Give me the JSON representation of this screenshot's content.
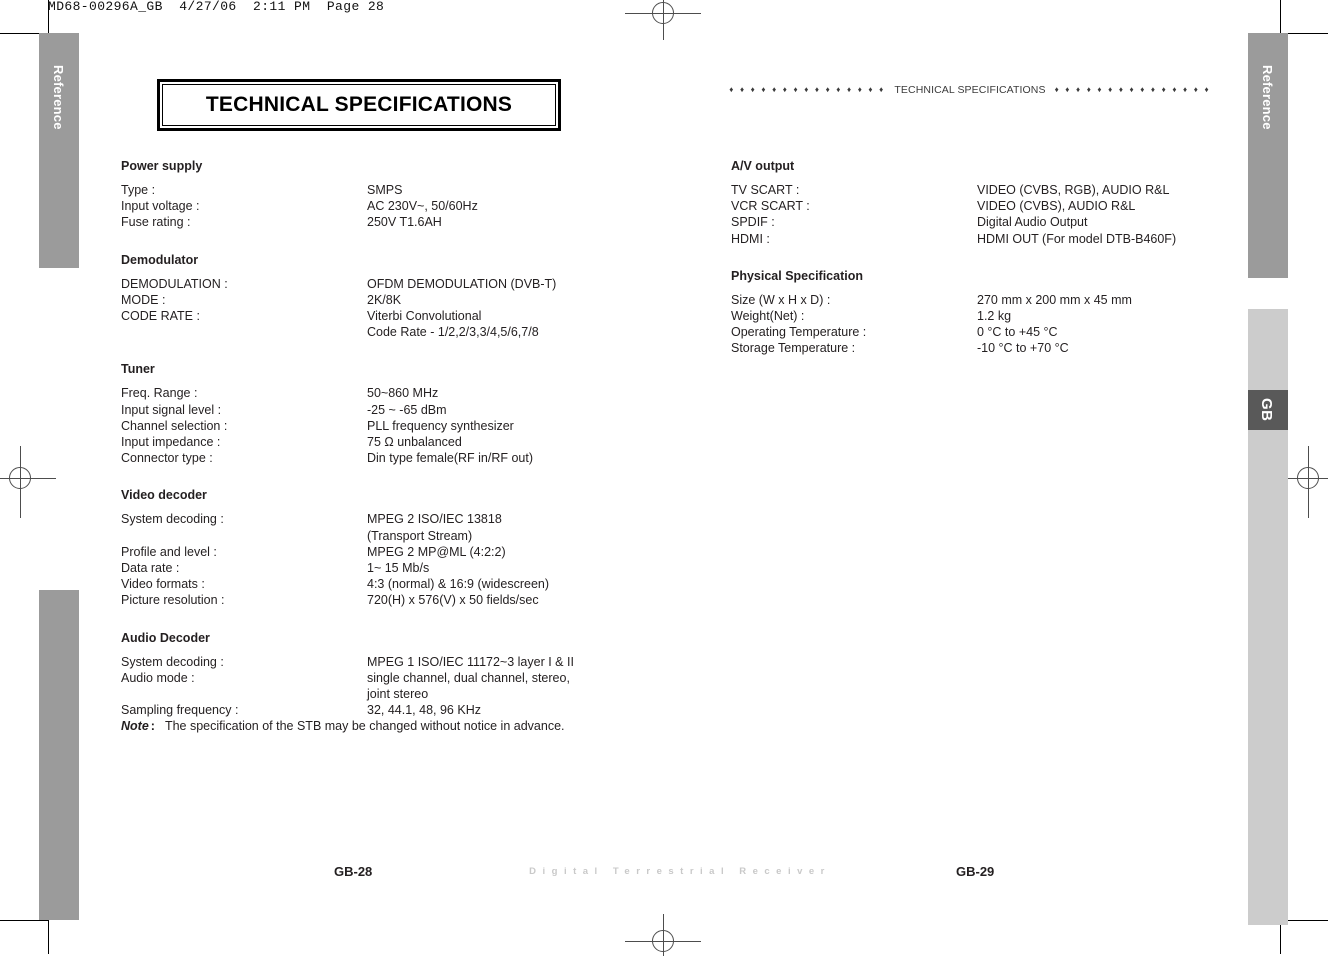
{
  "page": {
    "slug": "MD68-00296A_GB  4/27/06  2:11 PM  Page 28",
    "title": "TECHNICAL SPECIFICATIONS",
    "running_head": "TECHNICAL SPECIFICATIONS",
    "running_head_dots_left": "♦ ♦ ♦ ♦ ♦ ♦ ♦ ♦ ♦ ♦ ♦ ♦ ♦ ♦ ♦",
    "running_head_dots_right": "♦ ♦ ♦ ♦ ♦ ♦ ♦ ♦ ♦ ♦ ♦ ♦ ♦ ♦ ♦"
  },
  "side_tabs": {
    "left_label": "Reference",
    "right_label": "Reference",
    "right_lang_tab": "GB"
  },
  "left_column": [
    {
      "title": "Power supply",
      "rows": [
        {
          "label": "Type :",
          "value": "SMPS"
        },
        {
          "label": "Input voltage :",
          "value": "AC 230V~, 50/60Hz"
        },
        {
          "label": "Fuse rating :",
          "value": "250V T1.6AH"
        }
      ]
    },
    {
      "title": "Demodulator",
      "rows": [
        {
          "label": "DEMODULATION :",
          "value": "OFDM DEMODULATION (DVB-T)"
        },
        {
          "label": "MODE :",
          "value": "2K/8K"
        },
        {
          "label": "CODE RATE :",
          "value": "Viterbi Convolutional",
          "cont": "Code Rate - 1/2,2/3,3/4,5/6,7/8"
        }
      ]
    },
    {
      "title": "Tuner",
      "rows": [
        {
          "label": "Freq. Range :",
          "value": "50~860 MHz"
        },
        {
          "label": "Input signal level :",
          "value": "-25 ~ -65 dBm"
        },
        {
          "label": "Channel selection :",
          "value": "PLL frequency synthesizer"
        },
        {
          "label": "Input impedance :",
          "value": "75 Ω unbalanced"
        },
        {
          "label": "Connector type :",
          "value": "Din type female(RF in/RF out)"
        }
      ]
    },
    {
      "title": "Video decoder",
      "rows": [
        {
          "label": "System decoding :",
          "value": "MPEG 2 ISO/IEC 13818",
          "cont": "(Transport Stream)"
        },
        {
          "label": "Profile and level :",
          "value": "MPEG 2 MP@ML (4:2:2)"
        },
        {
          "label": "Data rate :",
          "value": "1~ 15 Mb/s"
        },
        {
          "label": "Video formats :",
          "value": "4:3 (normal) & 16:9 (widescreen)"
        },
        {
          "label": "Picture resolution :",
          "value": "720(H) x 576(V) x 50 fields/sec"
        }
      ]
    },
    {
      "title": "Audio Decoder",
      "rows": [
        {
          "label": "System decoding :",
          "value": "MPEG 1 ISO/IEC 11172~3 layer I & II"
        },
        {
          "label": "Audio mode :",
          "value": "single channel, dual channel, stereo,",
          "cont": "joint stereo"
        },
        {
          "label": "Sampling frequency :",
          "value": "32, 44.1, 48, 96 KHz"
        }
      ]
    }
  ],
  "right_column": [
    {
      "title": "A/V output",
      "rows": [
        {
          "label": "TV SCART :",
          "value": "VIDEO (CVBS, RGB), AUDIO R&L"
        },
        {
          "label": "VCR SCART :",
          "value": "VIDEO (CVBS), AUDIO R&L"
        },
        {
          "label": "SPDIF :",
          "value": "Digital Audio Output"
        },
        {
          "label": "HDMI :",
          "value": "HDMI OUT (For model DTB-B460F)"
        }
      ]
    },
    {
      "title": "Physical Specification",
      "rows": [
        {
          "label": "Size (W x H x D) :",
          "value": "270 mm x 200 mm x 45 mm"
        },
        {
          "label": "Weight(Net) :",
          "value": "1.2 kg"
        },
        {
          "label": "Operating Temperature :",
          "value": "0 °C to +45 °C"
        },
        {
          "label": "Storage Temperature :",
          "value": "-10 °C to +70 °C"
        }
      ]
    }
  ],
  "note": {
    "word": "Note",
    "colon": ":",
    "text": "The specification of the STB may be changed without notice in advance."
  },
  "footer": {
    "folio_left": "GB-28",
    "folio_right": "GB-29",
    "brand": "Digital Terrestrial Receiver"
  },
  "colors": {
    "band_dark": "#9b9b9b",
    "band_light": "#cccccc",
    "band_gb": "#595959",
    "text": "#231f20",
    "footer_brand": "#c9c9c9"
  }
}
